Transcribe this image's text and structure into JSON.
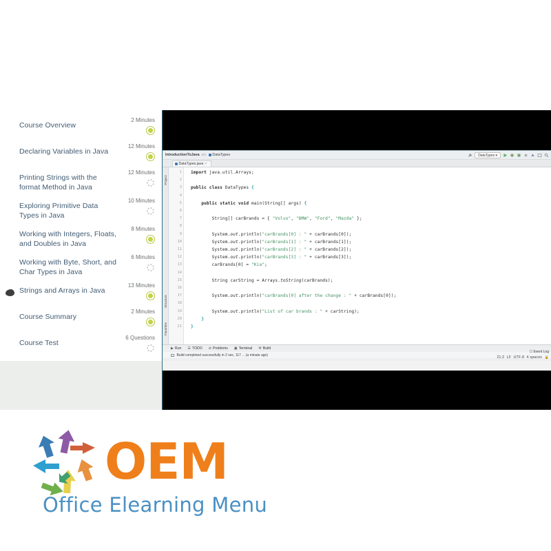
{
  "player": {
    "curriculum": {
      "lessons": [
        {
          "title": "Course Overview",
          "duration": "2 Minutes",
          "status": "done",
          "current": false
        },
        {
          "title": "Declaring Variables in Java",
          "duration": "12 Minutes",
          "status": "done",
          "current": false
        },
        {
          "title": "Printing Strings with the format Method in Java",
          "duration": "12 Minutes",
          "status": "todo",
          "current": false
        },
        {
          "title": "Exploring Primitive Data Types in Java",
          "duration": "10 Minutes",
          "status": "todo",
          "current": false
        },
        {
          "title": "Working with Integers, Floats, and Doubles in Java",
          "duration": "8 Minutes",
          "status": "done",
          "current": false
        },
        {
          "title": "Working with Byte, Short, and Char Types in Java",
          "duration": "6 Minutes",
          "status": "todo",
          "current": false
        },
        {
          "title": "Strings and Arrays in Java",
          "duration": "13 Minutes",
          "status": "done",
          "current": true
        },
        {
          "title": "Course Summary",
          "duration": "2 Minutes",
          "status": "done",
          "current": false
        },
        {
          "title": "Course Test",
          "duration": "6 Questions",
          "status": "todo",
          "current": false
        }
      ]
    },
    "video": {
      "ide": {
        "breadcrumb": {
          "project": "IntroductionToJava",
          "sep1": "src",
          "file": "DataTypes"
        },
        "tab_label": "DataTypes.java",
        "toolbar": {
          "run_config": "DataTypes",
          "icons": [
            "wrench-icon",
            "run-icon",
            "debug-icon",
            "coverage-icon",
            "stop-icon",
            "build-icon",
            "layout-icon",
            "search-icon"
          ]
        },
        "rails": {
          "project": "Project",
          "structure": "Structure",
          "favorites": "Favorites"
        },
        "line_numbers": [
          "1",
          "2",
          "3",
          "4",
          "5",
          "6",
          "7",
          "8",
          "9",
          "10",
          "11",
          "12",
          "13",
          "14",
          "15",
          "16",
          "17",
          "18",
          "19",
          "20",
          "21"
        ],
        "fold_lines": [
          3,
          5
        ],
        "code_lines": [
          "import java.util.Arrays;",
          "",
          "public class DataTypes {",
          "",
          "    public static void main(String[] args) {",
          "",
          "        String[] carBrands = { \"Volvo\", \"BMW\", \"Ford\", \"Mazda\" };",
          "",
          "        System.out.println(\"carBrands[0] : \" + carBrands[0]);",
          "        System.out.println(\"carBrands[1] : \" + carBrands[1]);",
          "        System.out.println(\"carBrands[2] : \" + carBrands[2]);",
          "        System.out.println(\"carBrands[3] : \" + carBrands[3]);",
          "        carBrands[0] = \"Kia\";",
          "",
          "        String carString = Arrays.toString(carBrands);",
          "",
          "        System.out.println(\"carBrands[0] after the change : \" + carBrands[0]);",
          "",
          "        System.out.println(\"List of car brands : \" + carString);",
          "    }",
          "}"
        ],
        "runbar": [
          {
            "icon": "run-icon",
            "label": "Run"
          },
          {
            "icon": "todo-icon",
            "label": "TODO"
          },
          {
            "icon": "problems-icon",
            "label": "Problems"
          },
          {
            "icon": "terminal-icon",
            "label": "Terminal"
          },
          {
            "icon": "build-icon",
            "label": "Build"
          }
        ],
        "status_message": "Build completed successfully in 2 sec, 117 ... (a minute ago)",
        "event_log": "Event Log",
        "caret_position": "21:2",
        "line_separator": "LF",
        "encoding": "UTF-8",
        "indent": "4 spaces"
      }
    }
  },
  "logo": {
    "title": "OEM",
    "subtitle": "Office Elearning Menu",
    "brand_orange": "#ef7f1a",
    "brand_blue": "#4a90c4",
    "arrow_colors": [
      "#3b7cb5",
      "#2f9fd0",
      "#8e5aa5",
      "#d1603a",
      "#e8913e",
      "#e8d04f",
      "#6fb04a",
      "#3f9f6f"
    ]
  }
}
